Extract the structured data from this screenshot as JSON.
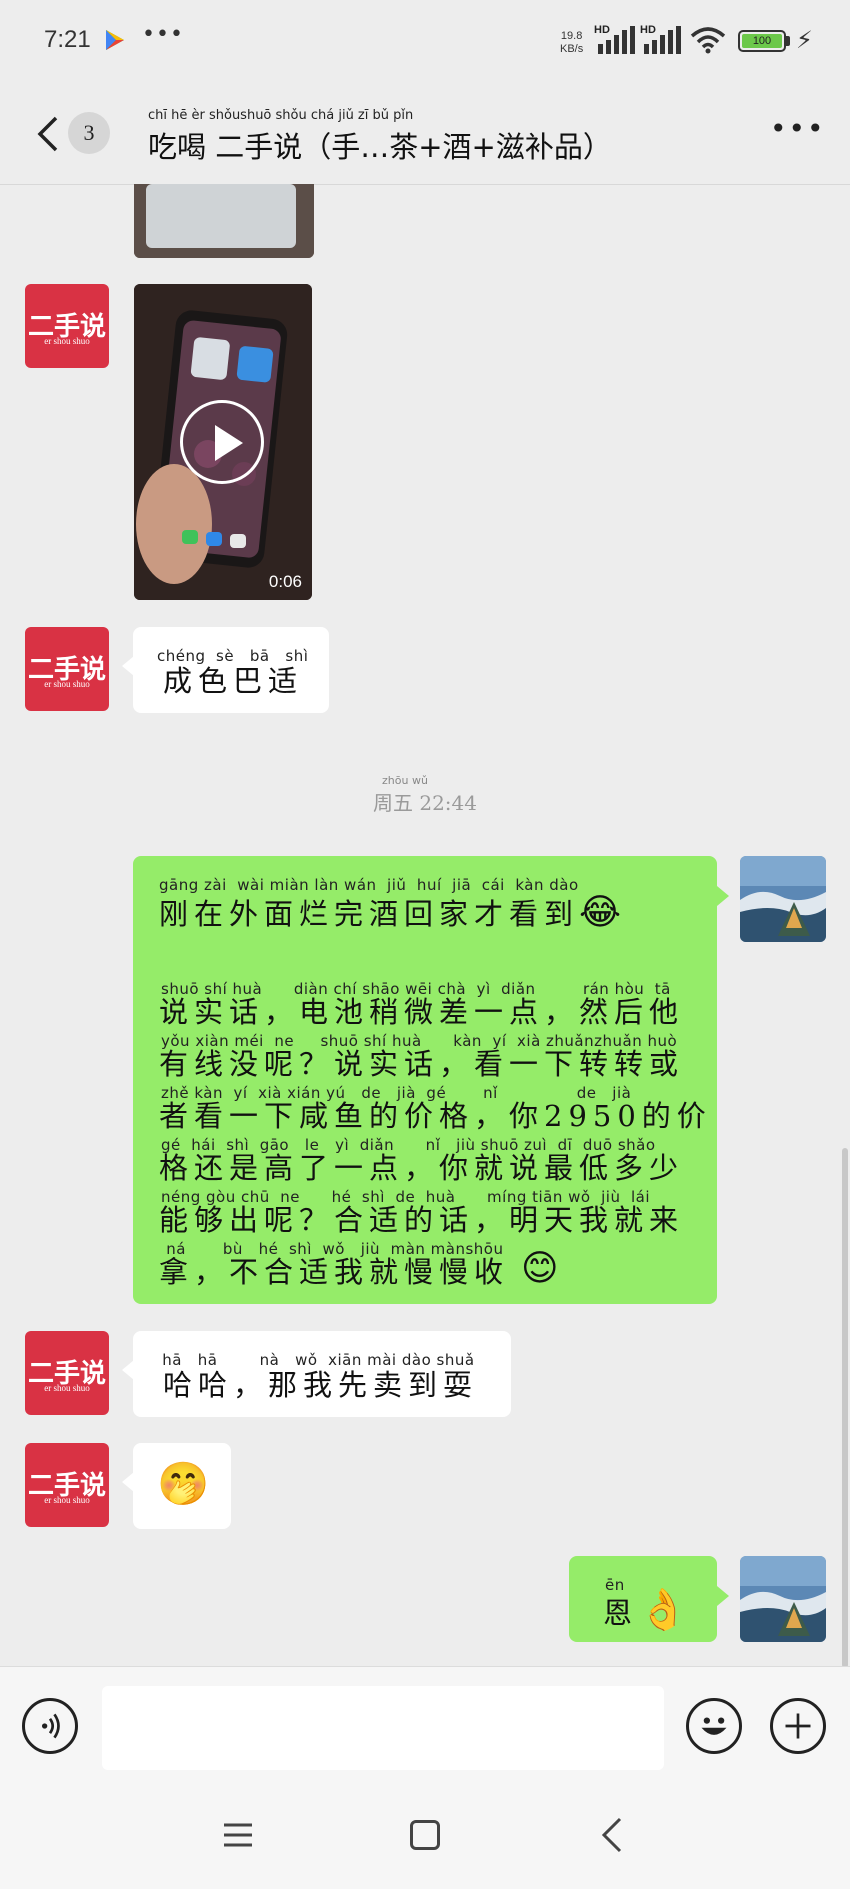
{
  "status_bar": {
    "time": "7:21",
    "more": "•••",
    "net_speed_value": "19.8",
    "net_speed_unit": "KB/s",
    "hd1": "HD",
    "hd2": "HD",
    "battery": "100"
  },
  "header": {
    "unread_count": "3",
    "title_pinyin": "chī  hē    èr shǒushuō       shǒu          chá        jiǔ        zī   bǔ   pǐn",
    "title_text": "吃喝 二手说（手…茶+酒+滋补品）",
    "menu": "•••"
  },
  "avatar_text": {
    "main": "二手说",
    "sub": "er shou shuo"
  },
  "messages": {
    "video_duration": "0:06",
    "msg1_pinyin": "chéng  sè   bā   shì",
    "msg1_text": "成色巴适",
    "timestamp_pinyin": "zhōu wǔ",
    "timestamp_text": "周五  22:44",
    "msg2_line1_py": "gāng zài  wài miàn làn wán  jiǔ  huí  jiā  cái  kàn dào",
    "msg2_line1": "刚在外面烂完酒回家才看到",
    "msg2_line1_emoji": "😂",
    "msg2_lines": [
      {
        "py": "shuō shí huà      diàn chí shāo wēi chà  yì  diǎn         rán hòu  tā",
        "text": "说实话，电池稍微差一点，然后他"
      },
      {
        "py": "yǒu xiàn méi  ne     shuō shí huà      kàn  yí  xià zhuǎnzhuǎn huò",
        "text": "有线没呢？说实话，看一下转转或"
      },
      {
        "py": "zhě kàn  yí  xià xián yú   de   jià  gé       nǐ               de   jià",
        "text": "者看一下咸鱼的价格，你2950的价"
      },
      {
        "py": "gé  hái  shì  gāo   le   yì  diǎn      nǐ   jiù shuō zuì  dī  duō shǎo",
        "text": "格还是高了一点，你就说最低多少"
      },
      {
        "py": "néng gòu chū  ne      hé  shì  de  huà      míng tiān wǒ  jiù  lái",
        "text": "能够出呢？合适的话，明天我就来"
      },
      {
        "py": " ná       bù   hé  shì  wǒ   jiù  màn mànshōu",
        "text": "拿，不合适我就慢慢收"
      }
    ],
    "msg2_end_emoji": "😊",
    "msg3_pinyin": " hā   hā        nà   wǒ  xiān mài dào shuǎ",
    "msg3_text": "哈哈，那我先卖到耍",
    "msg4_emoji": "🤭",
    "msg5_pinyin": "ēn",
    "msg5_text": "恩",
    "msg5_emoji": "👌"
  },
  "composer": {
    "input_value": "",
    "input_placeholder": ""
  },
  "colors": {
    "background": "#ededed",
    "bubble_out": "#95ec69",
    "bubble_in": "#ffffff",
    "avatar_brand": "#d93244"
  }
}
